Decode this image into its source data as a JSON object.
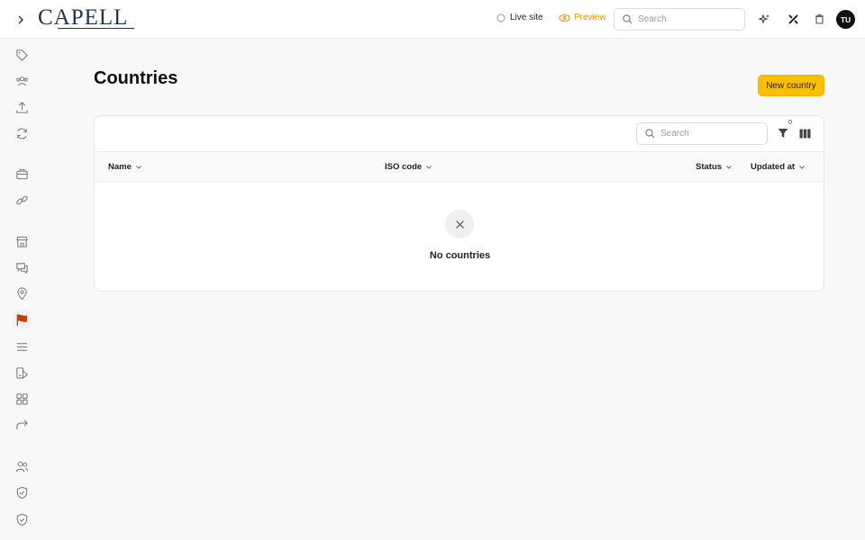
{
  "app": {
    "logo": "CAPELL"
  },
  "topbar": {
    "live_site": "Live site",
    "preview": "Preview",
    "search_placeholder": "Search",
    "avatar_initials": "TU"
  },
  "sidebar": {
    "items": [
      {
        "icon": "tag-icon"
      },
      {
        "icon": "users-group-icon"
      },
      {
        "icon": "upload-icon"
      },
      {
        "icon": "refresh-icon"
      },
      {
        "icon": "briefcase-icon"
      },
      {
        "icon": "link-icon"
      },
      {
        "icon": "store-icon"
      },
      {
        "icon": "chat-icon"
      },
      {
        "icon": "map-pin-icon"
      },
      {
        "icon": "flag-icon",
        "active": true
      },
      {
        "icon": "menu-icon"
      },
      {
        "icon": "shapes-icon"
      },
      {
        "icon": "grid-icon"
      },
      {
        "icon": "redirect-icon"
      },
      {
        "icon": "users-icon"
      },
      {
        "icon": "shield-check-icon"
      },
      {
        "icon": "shield-check-icon"
      }
    ]
  },
  "page": {
    "title": "Countries",
    "new_button": "New country"
  },
  "table": {
    "search_placeholder": "Search",
    "filter_count": "0",
    "columns": [
      "Name",
      "ISO code",
      "Status",
      "Updated at"
    ],
    "empty_text": "No countries"
  },
  "colors": {
    "accent": "#fbbf00",
    "preview": "#e89400",
    "active_icon": "#c2410c"
  }
}
